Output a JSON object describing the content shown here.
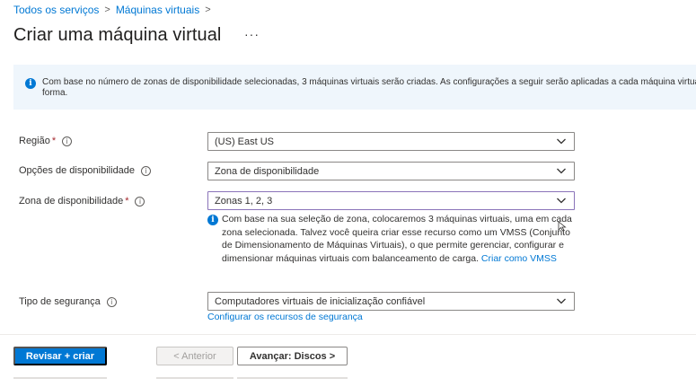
{
  "breadcrumb": {
    "items": [
      {
        "label": "Todos os serviços"
      },
      {
        "label": "Máquinas virtuais"
      }
    ],
    "separator": ">"
  },
  "page": {
    "title": "Criar uma máquina virtual",
    "more_label": "···"
  },
  "banner": {
    "text_line1": "Com base no número de zonas de disponibilidade selecionadas, 3 máquinas virtuais serão criadas. As configurações a seguir serão aplicadas a cada máquina virtual,",
    "text_line2": "forma.",
    "icon": "info-icon"
  },
  "form": {
    "region": {
      "label": "Região",
      "required": "*",
      "value": "(US) East US"
    },
    "availability_options": {
      "label": "Opções de disponibilidade",
      "value": "Zona de disponibilidade"
    },
    "availability_zone": {
      "label": "Zona de disponibilidade",
      "required": "*",
      "value": "Zonas 1, 2, 3"
    },
    "zone_info": {
      "line1": "Com base na sua seleção de zona, colocaremos 3 máquinas virtuais, uma em cada",
      "line2": "zona selecionada. Talvez você queira criar esse recurso como um VMSS (Conjunto",
      "line3": "de Dimensionamento de Máquinas Virtuais), o que permite gerenciar, configurar e",
      "line4": "dimensionar máquinas virtuais com balanceamento de carga.",
      "link": "Criar como VMSS"
    },
    "security_type": {
      "label": "Tipo de segurança",
      "value": "Computadores virtuais de inicialização confiável",
      "link": "Configurar os recursos de segurança"
    },
    "help_glyph": "i"
  },
  "footer": {
    "review_create": "Revisar + criar",
    "previous": "< Anterior",
    "next": "Avançar: Discos >"
  },
  "colors": {
    "accent": "#0078d4",
    "banner_bg": "#eff6fc",
    "required": "#a4262c",
    "focus_border": "#8a73b9"
  }
}
